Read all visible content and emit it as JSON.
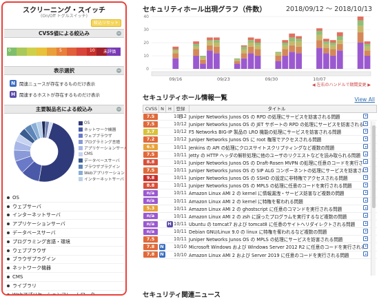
{
  "left": {
    "title": "スクリーニング・スイッチ",
    "subtitle": "(On/Off トグルスイッチ)",
    "reset_label": "絞込リセット",
    "cvss_head": "CVSS値による絞込み",
    "cvss_labels": [
      "0",
      "5",
      "10",
      "未評価"
    ],
    "display_head": "表示選択",
    "filter_n_label": "関連ニュースが存在するものだけ表示",
    "filter_h_label": "関連するホストが存在するものだけ表示",
    "product_head": "主要製品名による絞込み",
    "legend": [
      {
        "label": "OS",
        "color": "#2f3a7a"
      },
      {
        "label": "ネットワーク機器",
        "color": "#4a5aa8"
      },
      {
        "label": "ウェブブラウザ",
        "color": "#6a7ac8"
      },
      {
        "label": "プログラミング言語",
        "color": "#8a9ad8"
      },
      {
        "label": "アプリケーションサーバ",
        "color": "#a9b8e6"
      },
      {
        "label": "CMS",
        "color": "#c7d3f0"
      },
      {
        "label": "データベースサーバ",
        "color": "#3a5c90"
      },
      {
        "label": "ブラウザプラグイン",
        "color": "#5e86b8"
      },
      {
        "label": "Webアプリケーション",
        "color": "#8aaed6"
      },
      {
        "label": "インターネットサーバ",
        "color": "#b9d0ea"
      }
    ],
    "donut": [
      48,
      10,
      7,
      6,
      5,
      4,
      4,
      4,
      3,
      3,
      2,
      2,
      2
    ],
    "categories": [
      "OS",
      "ウェブサーバ",
      "インターネットサーバ",
      "アプリケーションサーバ",
      "データベースサーバ",
      "プログラミング言語・環境",
      "ウェブブラウザ",
      "ブラウザプラグイン",
      "ネットワーク機器",
      "CMS",
      "ライブラリ",
      "Webアプリケーションフレームワーク"
    ]
  },
  "graph": {
    "title": "セキュリティホール出現グラフ（件数）",
    "date_range": "2018/09/12 〜 2018/10/13",
    "x_labels": [
      "09/16",
      "09/23",
      "09/30",
      "10/07"
    ],
    "y_ticks": [
      "0",
      "10",
      "20",
      "30",
      "40"
    ],
    "hint": "◀ 左右のハンドルで期間変更 ▶"
  },
  "chart_data": {
    "type": "bar",
    "title": "セキュリティホール出現グラフ（件数）",
    "ylim": [
      0,
      40
    ],
    "stacked": true,
    "series_colors": [
      "#9b59d0",
      "#d4885a",
      "#c6b86a",
      "#8fbf7a",
      "#e07060"
    ],
    "values": [
      [
        0,
        0,
        0,
        0,
        0
      ],
      [
        0,
        0,
        0,
        0,
        0
      ],
      [
        0,
        0,
        0,
        0,
        0
      ],
      [
        8,
        4,
        2,
        1,
        2
      ],
      [
        0,
        0,
        0,
        0,
        0
      ],
      [
        0,
        0,
        0,
        0,
        0
      ],
      [
        10,
        5,
        2,
        2,
        2
      ],
      [
        4,
        3,
        2,
        1,
        0
      ],
      [
        14,
        4,
        3,
        1,
        2
      ],
      [
        12,
        5,
        3,
        2,
        2
      ],
      [
        0,
        0,
        0,
        0,
        0
      ],
      [
        0,
        0,
        0,
        0,
        0
      ],
      [
        4,
        2,
        1,
        1,
        0
      ],
      [
        8,
        4,
        3,
        2,
        1
      ],
      [
        12,
        5,
        3,
        2,
        2
      ],
      [
        10,
        5,
        3,
        2,
        3
      ],
      [
        0,
        0,
        0,
        0,
        0
      ],
      [
        0,
        0,
        0,
        0,
        0
      ],
      [
        6,
        4,
        2,
        1,
        0
      ],
      [
        10,
        5,
        3,
        2,
        2
      ],
      [
        13,
        5,
        3,
        3,
        3
      ],
      [
        12,
        5,
        4,
        2,
        2
      ],
      [
        0,
        0,
        0,
        0,
        0
      ],
      [
        0,
        0,
        0,
        0,
        0
      ],
      [
        16,
        6,
        4,
        3,
        2
      ],
      [
        12,
        4,
        3,
        2,
        2
      ],
      [
        10,
        5,
        3,
        2,
        2
      ],
      [
        14,
        5,
        3,
        3,
        3
      ],
      [
        0,
        0,
        0,
        0,
        0
      ],
      [
        0,
        0,
        0,
        0,
        0
      ],
      [
        20,
        8,
        5,
        4,
        3
      ],
      [
        10,
        4,
        3,
        2,
        2
      ]
    ]
  },
  "list": {
    "title": "セキュリティホール情報一覧",
    "view_all": "View All",
    "headers": [
      "CVSS",
      "N",
      "H",
      "登録日",
      "タイトル"
    ],
    "rows": [
      {
        "cvss": "7.5",
        "n": "",
        "h": "",
        "date": "10/12",
        "title": "Juniper Networks Junos OS の RPD の処理にサービスを妨害される問題",
        "color": "#e06a3a"
      },
      {
        "cvss": "7.5",
        "n": "",
        "h": "",
        "date": "10/12",
        "title": "Juniper Networks Junos OS の JET サポートの RPD の処理にサービスを妨害される問題",
        "color": "#e06a3a"
      },
      {
        "cvss": "3.7",
        "n": "",
        "h": "",
        "date": "10/12",
        "title": "F5 Networks BIG-IP 製品の LRO 機能の処理にサービスを妨害される問題",
        "color": "#d9c23a"
      },
      {
        "cvss": "7.2",
        "n": "",
        "h": "",
        "date": "10/12",
        "title": "Juniper Networks Junos OS に root 権限でアクセスされる問題",
        "color": "#e06a3a"
      },
      {
        "cvss": "6.5",
        "n": "",
        "h": "",
        "date": "10/11",
        "title": "Jenkins の API の処理にクロスサイトスクリプティングなど複数の問題",
        "color": "#e8a23a"
      },
      {
        "cvss": "7.5",
        "n": "",
        "h": "",
        "date": "10/11",
        "title": "Jetty の HTTP ヘッダの解析処理に他のユーザのリクエストなどを読み取られる問題",
        "color": "#e06a3a"
      },
      {
        "cvss": "8.8",
        "n": "",
        "h": "",
        "date": "10/11",
        "title": "Juniper Networks Junos OS の Draft-Rosen MVPN の処理に任意のコードを実行される問題",
        "color": "#d9503a"
      },
      {
        "cvss": "7.5",
        "n": "",
        "h": "",
        "date": "10/11",
        "title": "Juniper Networks Junos OS の SIP ALG コンポーネントの処理にサービスを妨害される問題",
        "color": "#e06a3a"
      },
      {
        "cvss": "9.8",
        "n": "",
        "h": "",
        "date": "10/11",
        "title": "Juniper Networks Junos OS の SSHD の設定に非特権でアクセスされる問題",
        "color": "#c8302a"
      },
      {
        "cvss": "8.8",
        "n": "",
        "h": "",
        "date": "10/11",
        "title": "Juniper Networks Junos OS の MPLS の処理に任意のコードを実行される問題",
        "color": "#d9503a"
      },
      {
        "cvss": "n/a",
        "n": "",
        "h": "",
        "date": "10/11",
        "title": "Amazon Linux AMI 2 の kernel に情報漏洩・サービス妨害など複数の問題",
        "color": "#9b59d0"
      },
      {
        "cvss": "n/a",
        "n": "",
        "h": "",
        "date": "10/11",
        "title": "Amazon Linux AMI 2 の kernel に特権を奪われる問題",
        "color": "#9b59d0"
      },
      {
        "cvss": "5.3",
        "n": "",
        "h": "",
        "date": "10/11",
        "title": "Amazon Linux AMI 2 の ghostscript に任意のコマンドを実行される問題",
        "color": "#e8a23a"
      },
      {
        "cvss": "n/a",
        "n": "",
        "h": "",
        "date": "10/11",
        "title": "Amazon Linux AMI 2 の zsh に誤ったプログラムを実行するなど複数の問題",
        "color": "#9b59d0"
      },
      {
        "cvss": "n/a",
        "n": "",
        "h": "H",
        "date": "10/11",
        "title": "Ubuntu の tomcat7 および tomcat8 に任意のサイトへリダイレクトされる問題",
        "color": "#9b59d0"
      },
      {
        "cvss": "n/a",
        "n": "",
        "h": "",
        "date": "10/11",
        "title": "Debian GNU/Linux 9.0 の linux に特権を奪われるなど複数の問題",
        "color": "#9b59d0"
      },
      {
        "cvss": "7.5",
        "n": "",
        "h": "",
        "date": "10/11",
        "title": "Juniper Networks Junos OS の MPLS の処理にサービスを妨害される問題",
        "color": "#e06a3a"
      },
      {
        "cvss": "7.8",
        "n": "N",
        "h": "",
        "date": "10/10",
        "title": "Microsoft Windows および Windows Server 2012 R2 に任意のコードを実行される問題",
        "color": "#e06a3a"
      },
      {
        "cvss": "7.8",
        "n": "N",
        "h": "",
        "date": "10/10",
        "title": "Amazon Linux AMI 2 および Server 2019 に任意のコードを実行される問題",
        "color": "#e06a3a"
      }
    ]
  },
  "news": {
    "title": "セキュリティ関連ニュース"
  }
}
